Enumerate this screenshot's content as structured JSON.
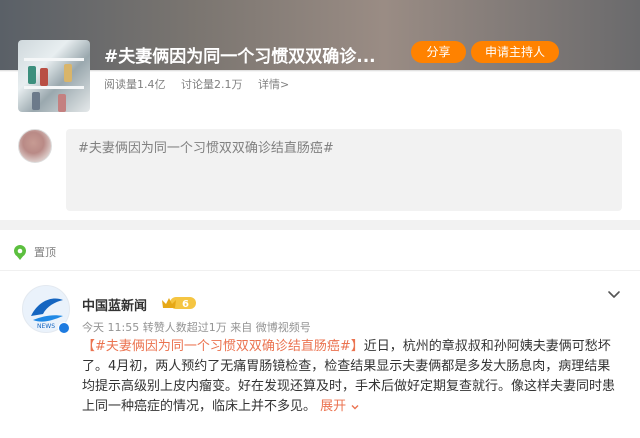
{
  "header": {
    "title": "#夫妻俩因为同一个习惯双双确诊...",
    "share_label": "分享",
    "host_label": "申请主持人",
    "stats": {
      "reads": "阅读量1.4亿",
      "discussions": "讨论量2.1万",
      "details": "详情>"
    }
  },
  "compose": {
    "text": "#夫妻俩因为同一个习惯双双确诊结直肠癌#"
  },
  "feed": {
    "pinned_label": "置顶",
    "author": {
      "name": "中国蓝新闻",
      "badge": "6"
    },
    "meta": {
      "time": "今天 11:55",
      "reposts": "转赞人数超过1万",
      "source": "来自 微博视频号"
    },
    "post": {
      "tag": "【#夫妻俩因为同一个习惯双双确诊结直肠癌#】",
      "text": "近日，杭州的章叔叔和孙阿姨夫妻俩可愁坏了。4月初，两人预约了无痛胃肠镜检查，检查结果显示夫妻俩都是多发大肠息肉，病理结果均提示高级别上皮内瘤变。好在发现还算及时，手术后做好定期复查就行。像这样夫妻同时患上同一种癌症的情况，临床上并不多见。",
      "more": "展开",
      "more_icon": "chevron-down-icon"
    }
  },
  "colors": {
    "accent": "#ff8200",
    "link": "#eb7350",
    "pin": "#5cbf3f",
    "verify": "#1e7be0"
  }
}
